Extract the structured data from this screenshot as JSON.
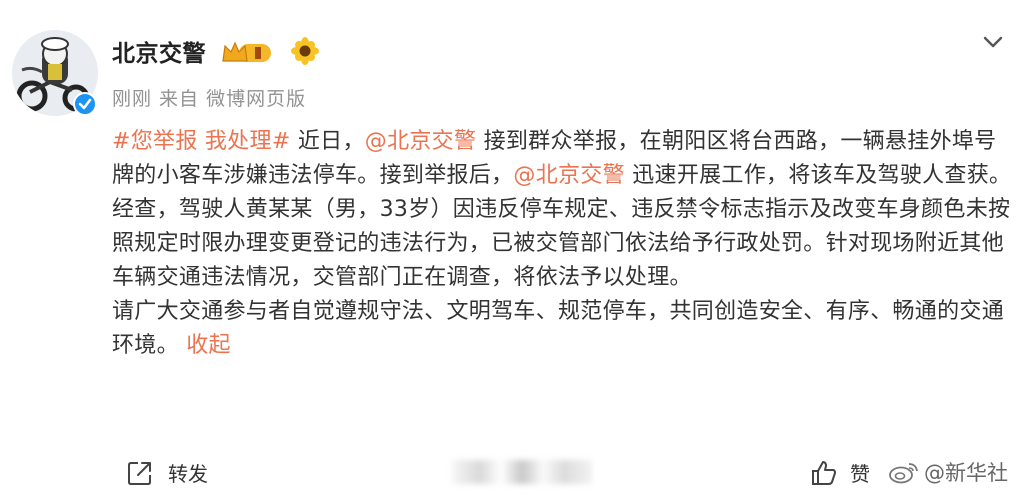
{
  "post": {
    "author": "北京交警",
    "meta": "刚刚 来自 微博网页版",
    "body": {
      "p1": [
        {
          "text": "#您举报 我处理#",
          "link": true
        },
        {
          "text": " 近日，",
          "link": false
        },
        {
          "text": "@北京交警",
          "link": true
        },
        {
          "text": " 接到群众举报，在朝阳区将台西路，一辆悬挂外埠号牌的小客车涉嫌违法停车。接到举报后，",
          "link": false
        },
        {
          "text": "@北京交警",
          "link": true
        },
        {
          "text": " 迅速开展工作，将该车及驾驶人查获。经查，驾驶人黄某某（男，33岁）因违反停车规定、违反禁令标志指示及改变车身颜色未按照规定时限办理变更登记的违法行为，已被交管部门依法给予行政处罚。针对现场附近其他车辆交通违法情况，交管部门正在调查，将依法予以处理。",
          "link": false
        }
      ],
      "p2": "请广大交通参与者自觉遵规守法、文明驾车、规范停车，共同创造安全、有序、畅通的交通环境。",
      "collapse_label": "收起"
    }
  },
  "footer": {
    "forward_label": "转发",
    "like_label": "赞",
    "watermark": "@新华社"
  },
  "colors": {
    "link": "#eb7350",
    "verified": "#1d93f2",
    "text": "#333333",
    "meta": "#939393"
  },
  "icons": {
    "chevron": "chevron-down-icon",
    "forward": "forward-icon",
    "like": "thumbs-up-icon",
    "verified": "verified-icon",
    "vip": "vip-crown-badge-icon",
    "flower": "sunflower-badge-icon",
    "weibo": "weibo-logo-icon"
  }
}
